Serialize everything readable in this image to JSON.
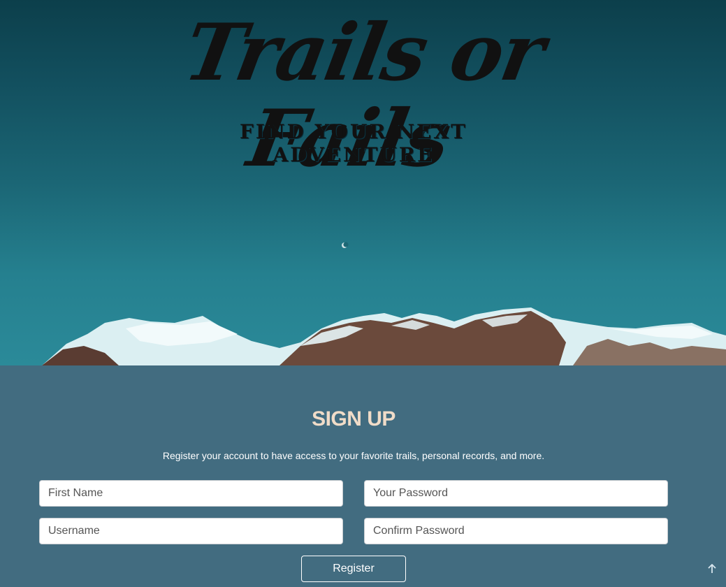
{
  "hero": {
    "title": "Trails or Fails",
    "tagline": "FIND YOUR NEXT ADVENTURE"
  },
  "signup": {
    "title": "SIGN UP",
    "description": "Register your account to have access to your favorite trails, personal records, and more.",
    "fields": {
      "first_name_placeholder": "First Name",
      "username_placeholder": "Username",
      "password_placeholder": "Your Password",
      "confirm_password_placeholder": "Confirm Password"
    },
    "register_label": "Register"
  },
  "scroll_top_icon": "arrow-up-icon",
  "colors": {
    "sky_top": "#0c3f4b",
    "sky_bottom": "#2b8a99",
    "section_bg": "#426c80",
    "heading": "#f0dcc8"
  }
}
